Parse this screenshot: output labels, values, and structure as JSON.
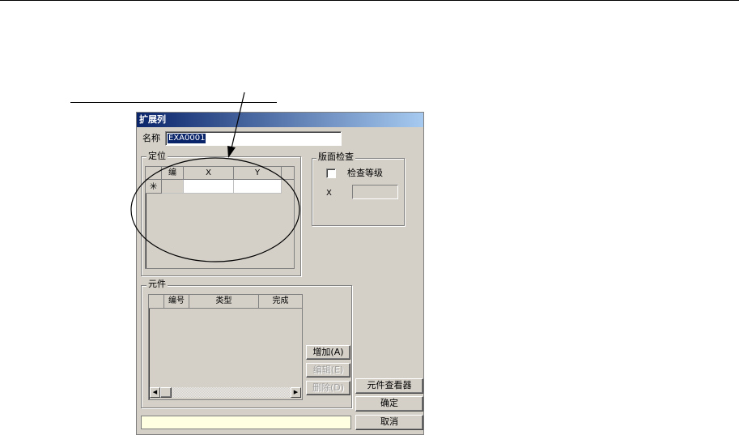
{
  "dialog": {
    "title": "扩展列",
    "name_label": "名称",
    "name_value": "EXA0001"
  },
  "positioning": {
    "group_title": "定位",
    "columns": [
      "编",
      "X",
      "Y"
    ],
    "new_row_marker": "✳"
  },
  "layout_check": {
    "group_title": "版面检查",
    "check_level_label": "检查等级",
    "check_level_checked": false,
    "x_label": "X",
    "x_value": ""
  },
  "components": {
    "group_title": "元件",
    "columns": [
      "编号",
      "类型",
      "完成"
    ],
    "add_button": "增加(A)",
    "edit_button": "编辑(E)",
    "delete_button": "删除(D)"
  },
  "buttons": {
    "viewer": "元件查看器",
    "ok": "确定",
    "cancel": "取消"
  },
  "status": {
    "text": ""
  }
}
